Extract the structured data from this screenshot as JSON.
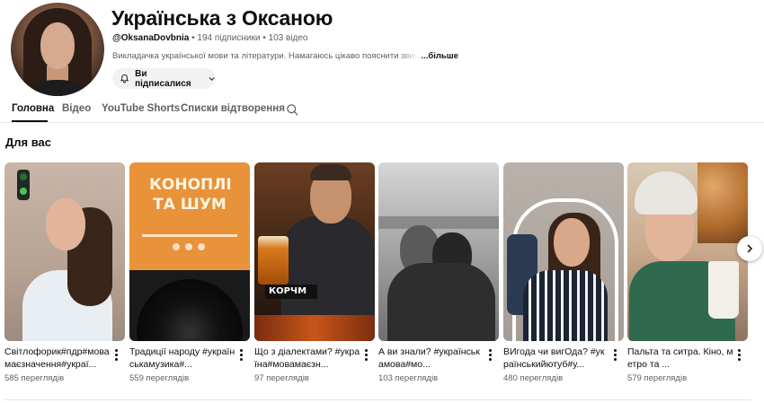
{
  "channel": {
    "title": "Українська з Оксаною",
    "handle": "@OksanaDovbnia",
    "subscribers": "194 підписники",
    "videos": "103 відео",
    "separator": "•",
    "description": "Викладачка української мови та літератури. Намагаюсь цікаво пояснити звич",
    "more": "...більше",
    "subscribe_label": "Ви підписалися"
  },
  "tabs": [
    {
      "label": "Головна",
      "active": true
    },
    {
      "label": "Відео",
      "active": false
    },
    {
      "label": "YouTube Shorts",
      "active": false
    },
    {
      "label": "Списки відтворення",
      "active": false
    }
  ],
  "section": {
    "title": "Для вас"
  },
  "shorts": [
    {
      "title": "Світлофорик#пдр#мовамаєзначення#украї...",
      "views": "585 переглядів"
    },
    {
      "title": "Традиції народу #українськамузика#...",
      "views": "559 переглядів",
      "overlay": "КОНОПЛІ ТА ШУМ"
    },
    {
      "title": "Що з діалектами? #україна#мовамаєзн...",
      "views": "97 переглядів",
      "overlay": "КОРЧМ"
    },
    {
      "title": "А ви знали? #українськамова#мо...",
      "views": "103 переглядів"
    },
    {
      "title": "ВИгода чи вигОда? #українськийютуб#у...",
      "views": "480 переглядів"
    },
    {
      "title": "Пальта та ситра. Кіно, метро та ...",
      "views": "579 переглядів"
    }
  ],
  "icons": {
    "search": "search-icon",
    "bell": "bell-icon",
    "chevron": "chevron-down-icon",
    "next": "chevron-right-icon",
    "more": "more-vert-icon"
  },
  "colors": {
    "text": "#0f0f0f",
    "secondary": "#606060",
    "chip": "#f2f2f2"
  }
}
